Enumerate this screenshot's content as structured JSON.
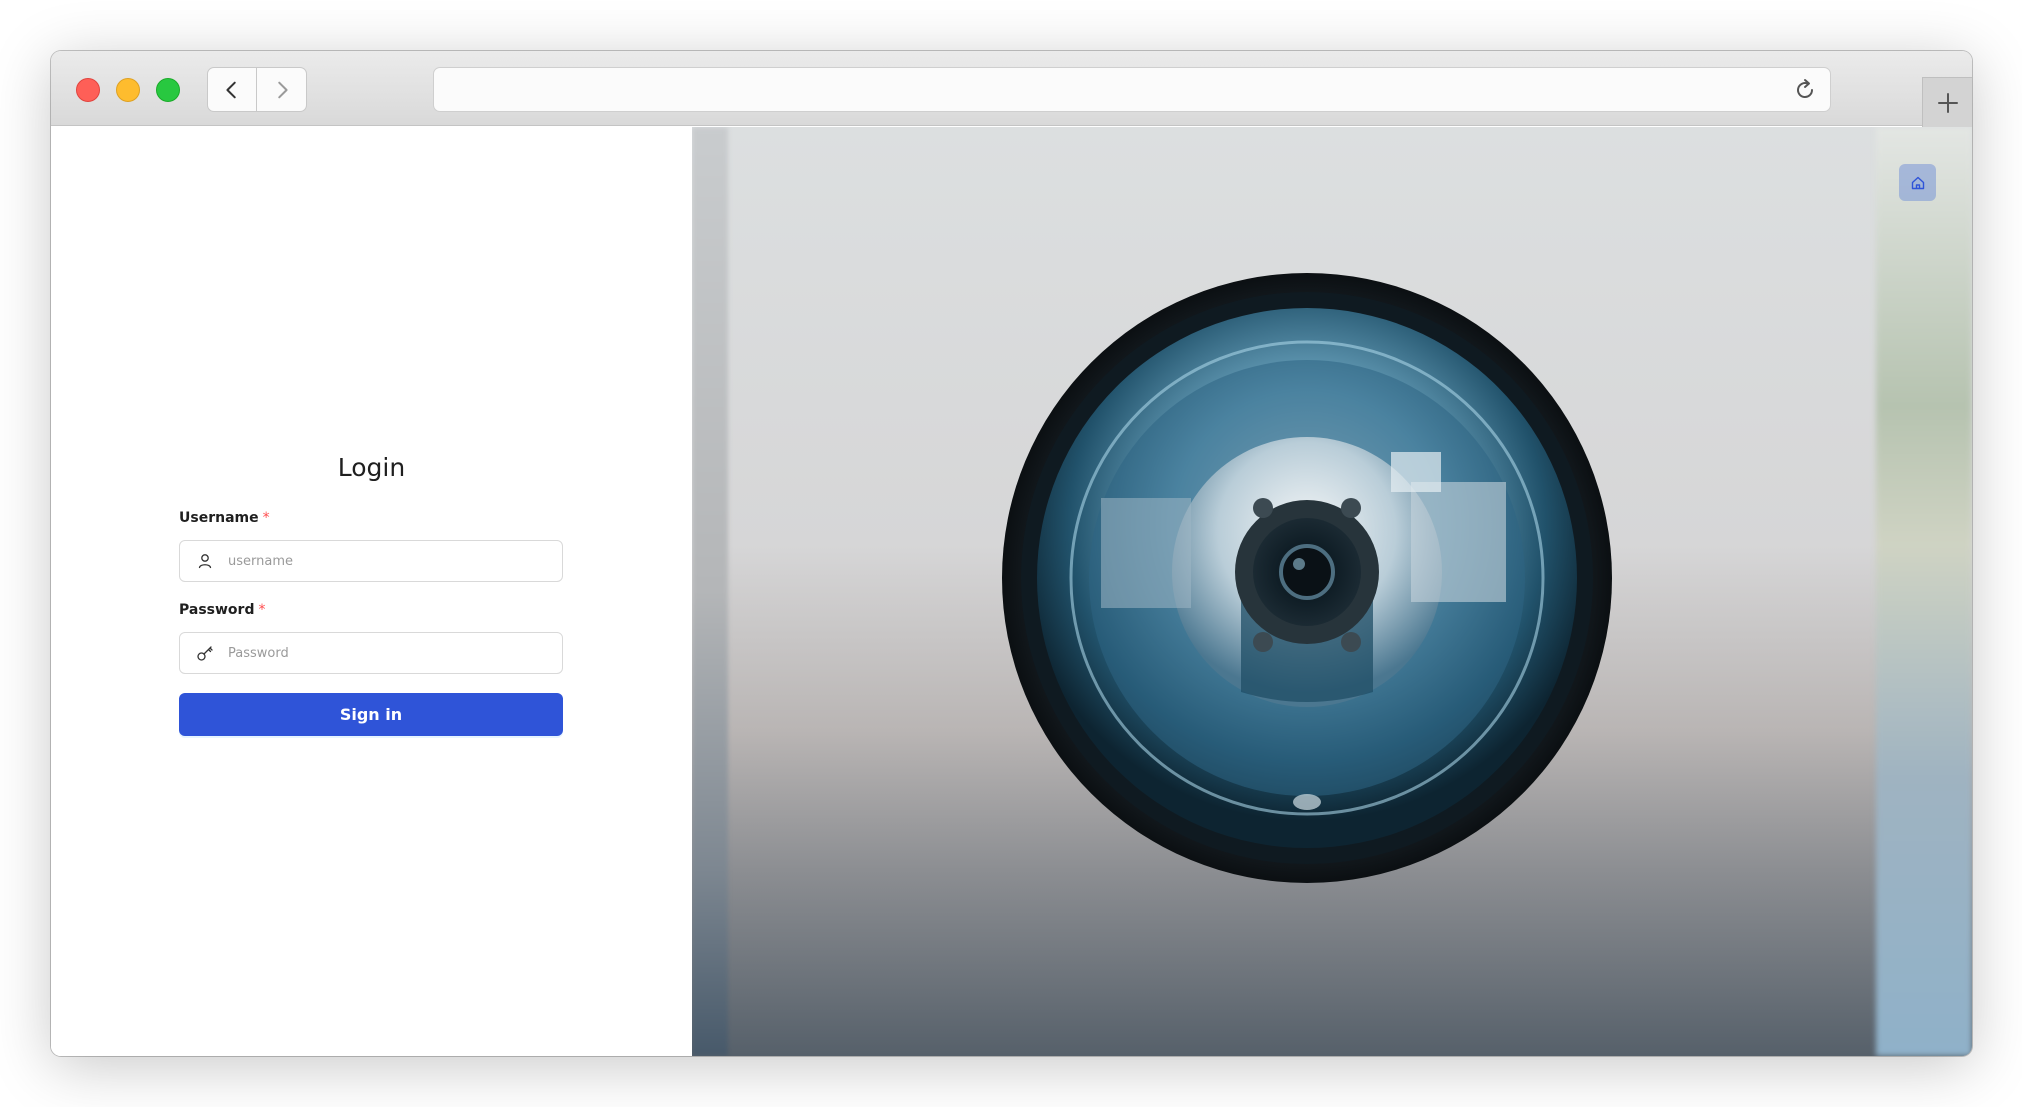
{
  "browser": {
    "url": "",
    "icons": {
      "back": "chevron-left-icon",
      "forward": "chevron-right-icon",
      "reload": "reload-icon",
      "new_tab": "plus-icon"
    }
  },
  "login": {
    "title": "Login",
    "username": {
      "label": "Username",
      "required_mark": "*",
      "placeholder": "username",
      "value": "",
      "icon": "user-icon"
    },
    "password": {
      "label": "Password",
      "required_mark": "*",
      "placeholder": "Password",
      "value": "",
      "icon": "key-icon"
    },
    "submit_label": "Sign in"
  },
  "hero": {
    "image": "security-camera-photo",
    "home_button_icon": "home-icon"
  },
  "colors": {
    "primary": "#2f54d8",
    "required": "#ff4d4f",
    "home_button": "#7896d7"
  }
}
